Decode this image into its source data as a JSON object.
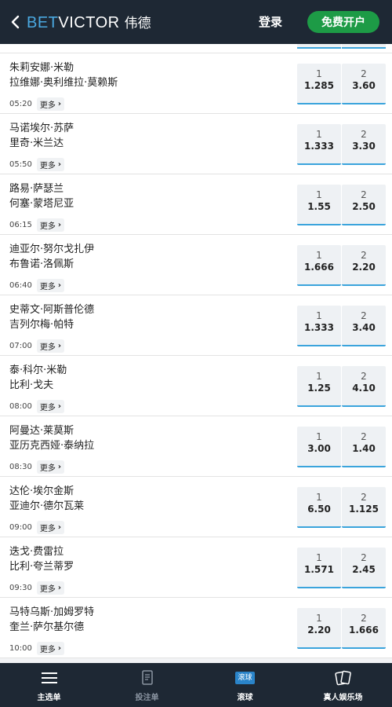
{
  "header": {
    "logo_bet": "BET",
    "logo_victor": "VICTOR",
    "logo_cn": "伟德",
    "login_label": "登录",
    "register_label": "免费开户"
  },
  "colors": {
    "header_bg": "#1e2834",
    "register_green": "#1d9b46",
    "accent_blue": "#3ba4dc"
  },
  "matches": [
    {
      "p1": "朱莉安娜·米勒",
      "p2": "拉维娜·奥利维拉·莫赖斯",
      "time": "05:20",
      "more": "更多",
      "o1_label": "1",
      "o1": "1.285",
      "o2_label": "2",
      "o2": "3.60"
    },
    {
      "p1": "马诺埃尔·苏萨",
      "p2": "里奇·米兰达",
      "time": "05:50",
      "more": "更多",
      "o1_label": "1",
      "o1": "1.333",
      "o2_label": "2",
      "o2": "3.30"
    },
    {
      "p1": "路易·萨瑟兰",
      "p2": "何塞·蒙塔尼亚",
      "time": "06:15",
      "more": "更多",
      "o1_label": "1",
      "o1": "1.55",
      "o2_label": "2",
      "o2": "2.50"
    },
    {
      "p1": "迪亚尔·努尔戈扎伊",
      "p2": "布鲁诺·洛佩斯",
      "time": "06:40",
      "more": "更多",
      "o1_label": "1",
      "o1": "1.666",
      "o2_label": "2",
      "o2": "2.20"
    },
    {
      "p1": "史蒂文·阿斯普伦德",
      "p2": "吉列尔梅·帕特",
      "time": "07:00",
      "more": "更多",
      "o1_label": "1",
      "o1": "1.333",
      "o2_label": "2",
      "o2": "3.40"
    },
    {
      "p1": "泰·科尔·米勒",
      "p2": "比利·戈夫",
      "time": "08:00",
      "more": "更多",
      "o1_label": "1",
      "o1": "1.25",
      "o2_label": "2",
      "o2": "4.10"
    },
    {
      "p1": "阿曼达·莱莫斯",
      "p2": "亚历克西娅·泰纳拉",
      "time": "08:30",
      "more": "更多",
      "o1_label": "1",
      "o1": "3.00",
      "o2_label": "2",
      "o2": "1.40"
    },
    {
      "p1": "达伦·埃尔金斯",
      "p2": "亚迪尔·德尔瓦莱",
      "time": "09:00",
      "more": "更多",
      "o1_label": "1",
      "o1": "6.50",
      "o2_label": "2",
      "o2": "1.125"
    },
    {
      "p1": "迭戈·费雷拉",
      "p2": "比利·夸兰蒂罗",
      "time": "09:30",
      "more": "更多",
      "o1_label": "1",
      "o1": "1.571",
      "o2_label": "2",
      "o2": "2.45"
    },
    {
      "p1": "马特乌斯·加姆罗特",
      "p2": "奎兰·萨尔基尔德",
      "time": "10:00",
      "more": "更多",
      "o1_label": "1",
      "o1": "2.20",
      "o2_label": "2",
      "o2": "1.666"
    }
  ],
  "bottom_nav": {
    "home": {
      "label": "主选单",
      "icon": "menu-icon"
    },
    "betslip": {
      "label": "投注单",
      "icon": "betslip-icon"
    },
    "live": {
      "label": "滚球",
      "badge": "滚球",
      "icon": "live-badge"
    },
    "casino": {
      "label": "真人娱乐场",
      "icon": "cards-icon"
    }
  }
}
